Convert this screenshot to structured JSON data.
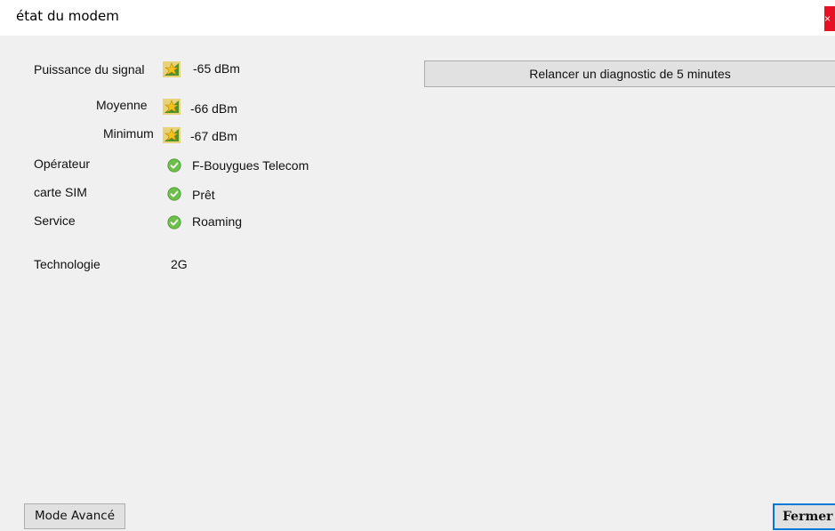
{
  "window": {
    "title": "état du modem",
    "close_glyph": "×"
  },
  "signal": {
    "label": "Puissance du signal",
    "value": "-65 dBm",
    "average_label": "Moyenne",
    "average_value": "-66 dBm",
    "minimum_label": "Minimum",
    "minimum_value": "-67 dBm",
    "icon": "signal-strength-icon"
  },
  "status": [
    {
      "label": "Opérateur",
      "value": "F-Bouygues Telecom",
      "icon": "ok-check-icon"
    },
    {
      "label": "carte SIM",
      "value": "Prêt",
      "icon": "ok-check-icon"
    },
    {
      "label": "Service",
      "value": "Roaming",
      "icon": "ok-check-icon"
    }
  ],
  "technology": {
    "label": "Technologie",
    "value": "2G"
  },
  "buttons": {
    "diagnostic": "Relancer un diagnostic de 5 minutes",
    "advanced_mode": "Mode Avancé",
    "close": "Fermer"
  },
  "colors": {
    "background": "#f0f0f0",
    "titlebar": "#ffffff",
    "close_red": "#e81123",
    "ok_green": "#6cbf4a",
    "focus_blue": "#0078d7"
  }
}
